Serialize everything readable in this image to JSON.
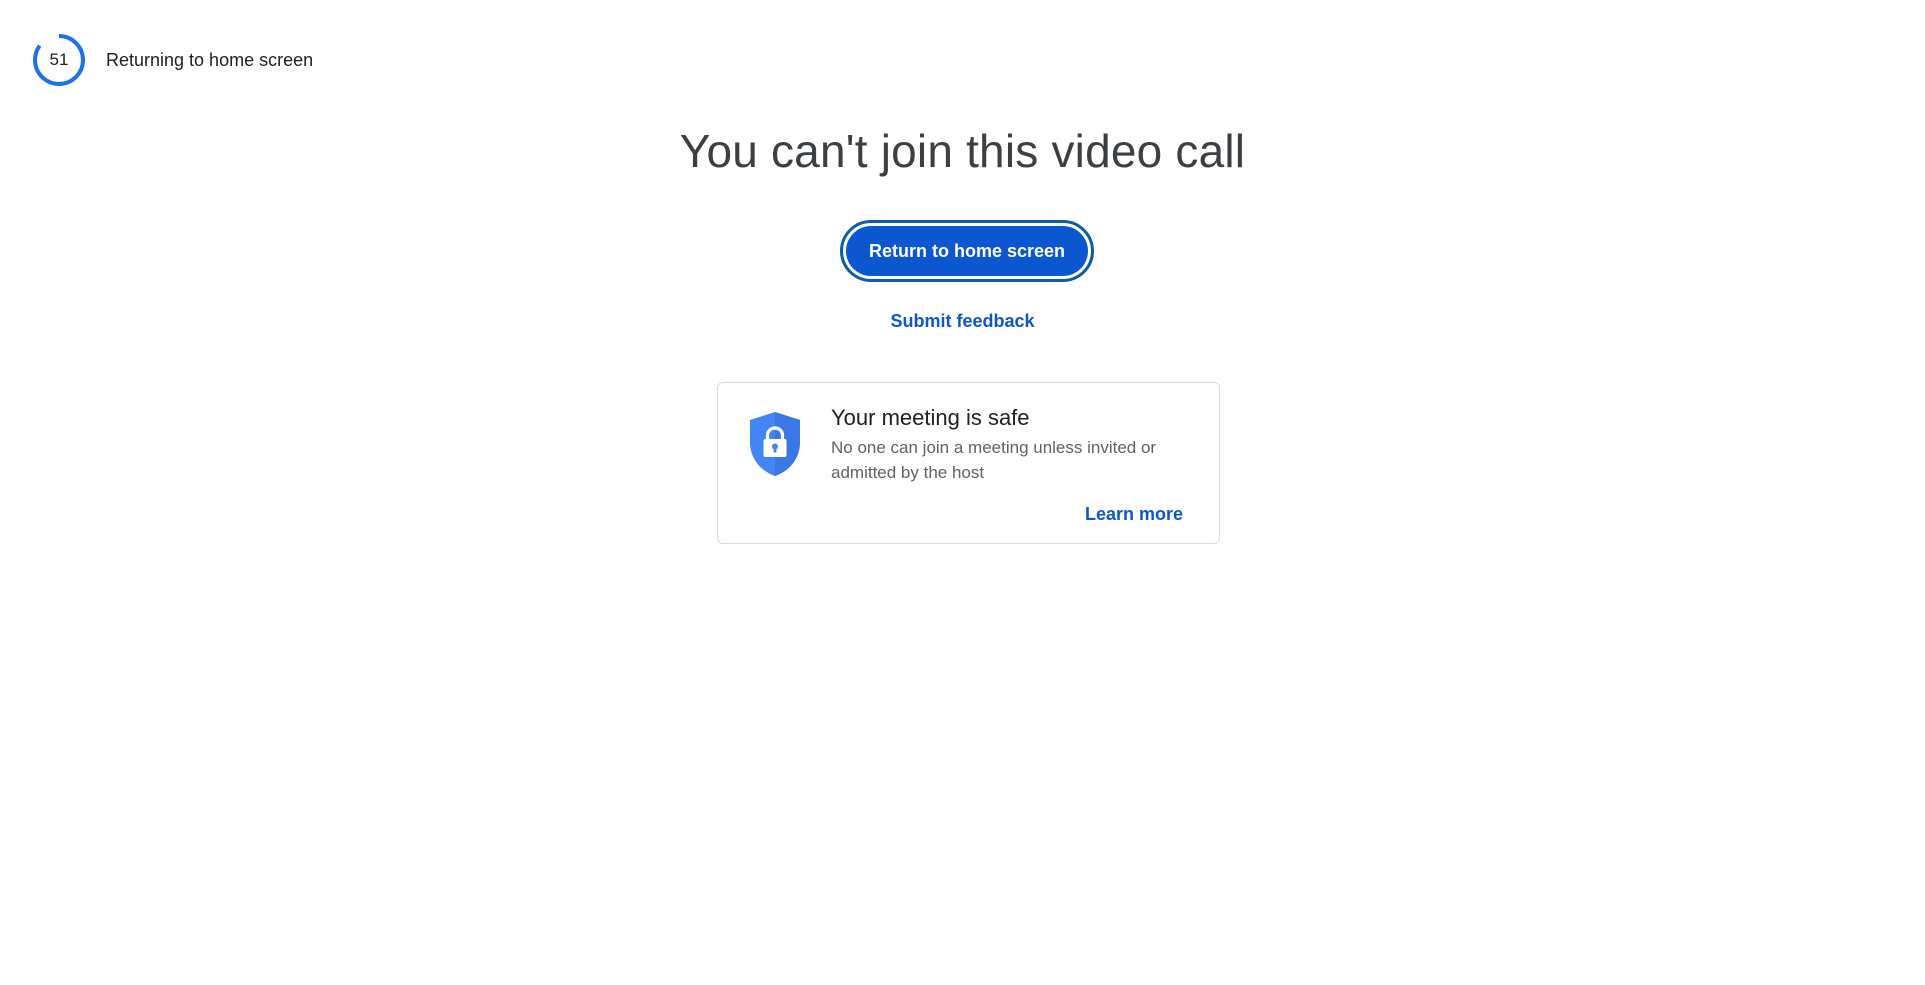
{
  "countdown": {
    "seconds": "51",
    "label": "Returning to home screen",
    "progress_fraction": 0.85,
    "ring_color": "#1a73e8"
  },
  "main": {
    "title": "You can't join this video call",
    "return_button_label": "Return to home screen",
    "feedback_link_label": "Submit feedback"
  },
  "safety_card": {
    "icon": "shield-lock-icon",
    "icon_color": "#4285f4",
    "title": "Your meeting is safe",
    "text": "No one can join a meeting unless invited or admitted by the host",
    "learn_more_label": "Learn more"
  },
  "colors": {
    "primary": "#0b57d0",
    "button_focus_ring": "#0b5cad",
    "title_text": "#3c4043",
    "secondary_text": "#5f6368"
  }
}
